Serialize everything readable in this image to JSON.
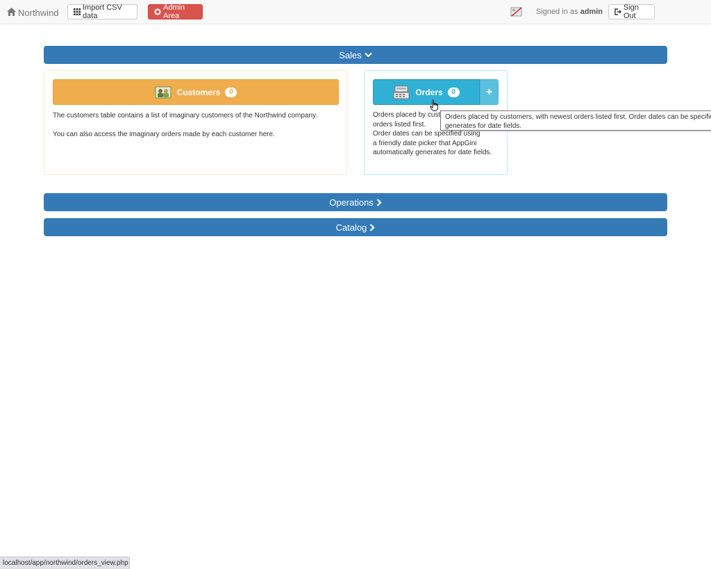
{
  "navbar": {
    "brand": "Northwind",
    "import_label": "Import CSV data",
    "admin_label": "Admin Area",
    "signed_in_prefix": "Signed in as",
    "username": "admin",
    "signout_label": "Sign Out"
  },
  "sections": {
    "sales": "Sales",
    "operations": "Operations",
    "catalog": "Catalog"
  },
  "customers": {
    "title": "Customers",
    "count": "0",
    "desc_line1": "The customers table contains a list of imaginary customers of the Northwind company.",
    "desc_line2": "You can also access the imaginary orders made by each customer here."
  },
  "orders": {
    "title": "Orders",
    "count": "0",
    "plus": "+",
    "desc_l1": "Orders placed by customers, with newest",
    "desc_l2": "orders listed first.",
    "desc_l3": "Order dates can be specified using",
    "desc_l4": "a friendly date picker that AppGini",
    "desc_l5": "automatically generates for date fields."
  },
  "tooltip": {
    "line1": "Orders placed by customers, with newest orders listed first. Order dates can be specified using a friendly date picker that AppGini automatically",
    "line2": "generates for date fields."
  },
  "statusbar": {
    "url": "localhost/app/northwind/orders_view.php"
  },
  "colors": {
    "primary": "#337ab7",
    "warning": "#f0ad4e",
    "info": "#31b0d5",
    "danger": "#d9534f"
  }
}
